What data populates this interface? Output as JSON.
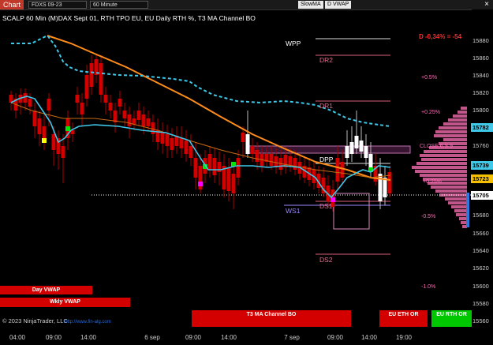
{
  "toolbar": {
    "chart_label": "Chart",
    "instrument": "FDXS 09-23",
    "interval": "60 Minute",
    "buttons": [
      "SlowMA",
      "D VWAP"
    ],
    "close_symbol": "×"
  },
  "chart_caption": "SCALP 60 Min (M)DAX Sept 01, RTH TPO EU, EU Daily RTH %, T3 MA Channel BO",
  "daily_change": "D -0,34% = -54",
  "percent_levels": [
    "+0.5%",
    "+0.25%",
    "+0.25%",
    "-0.5%",
    "-1.0%"
  ],
  "levels": {
    "wpp": "WPP",
    "dr2": "DR2",
    "dr1": "DR1",
    "dpp": "DPP",
    "close": "CLOSE 6.S.9",
    "ws1": "WS1",
    "ds1": "DS1",
    "ds2": "DS2"
  },
  "price_axis": {
    "ticks": [
      "15880",
      "15860",
      "15840",
      "15820",
      "15800",
      "15780",
      "15760",
      "15740",
      "15720",
      "15700",
      "15680",
      "15660",
      "15640",
      "15620",
      "15600",
      "15580",
      "15560"
    ],
    "tags": [
      {
        "text": "15782",
        "color": "#3fc8e8"
      },
      {
        "text": "15739",
        "color": "#3fc8e8"
      },
      {
        "text": "15723",
        "color": "#f5c000"
      },
      {
        "text": "15705",
        "color": "#ffffff"
      }
    ]
  },
  "time_axis": [
    "04:00",
    "09:00",
    "14:00",
    "6 sep",
    "09:00",
    "14:00",
    "7 sep",
    "09:00",
    "14:00",
    "19:00"
  ],
  "indicators": {
    "day_vwap": "Day VWAP",
    "wkly_vwap": "Wkly VWAP",
    "t3_channel": "T3 MA Channel BO",
    "eu_eth": "EU ETH OR",
    "eu_rth": "EU RTH OR"
  },
  "footer": {
    "copyright": "© 2023 NinjaTrader, LLC",
    "url": "http://www.fin-alg.com"
  },
  "colors": {
    "up": "#d40000",
    "down": "#ffffff",
    "cyan_ma": "#3fc8e8",
    "orange_ma": "#ff8c1a",
    "magenta": "#ff00ff",
    "green": "#00e600",
    "profile": "#c0568a"
  }
}
